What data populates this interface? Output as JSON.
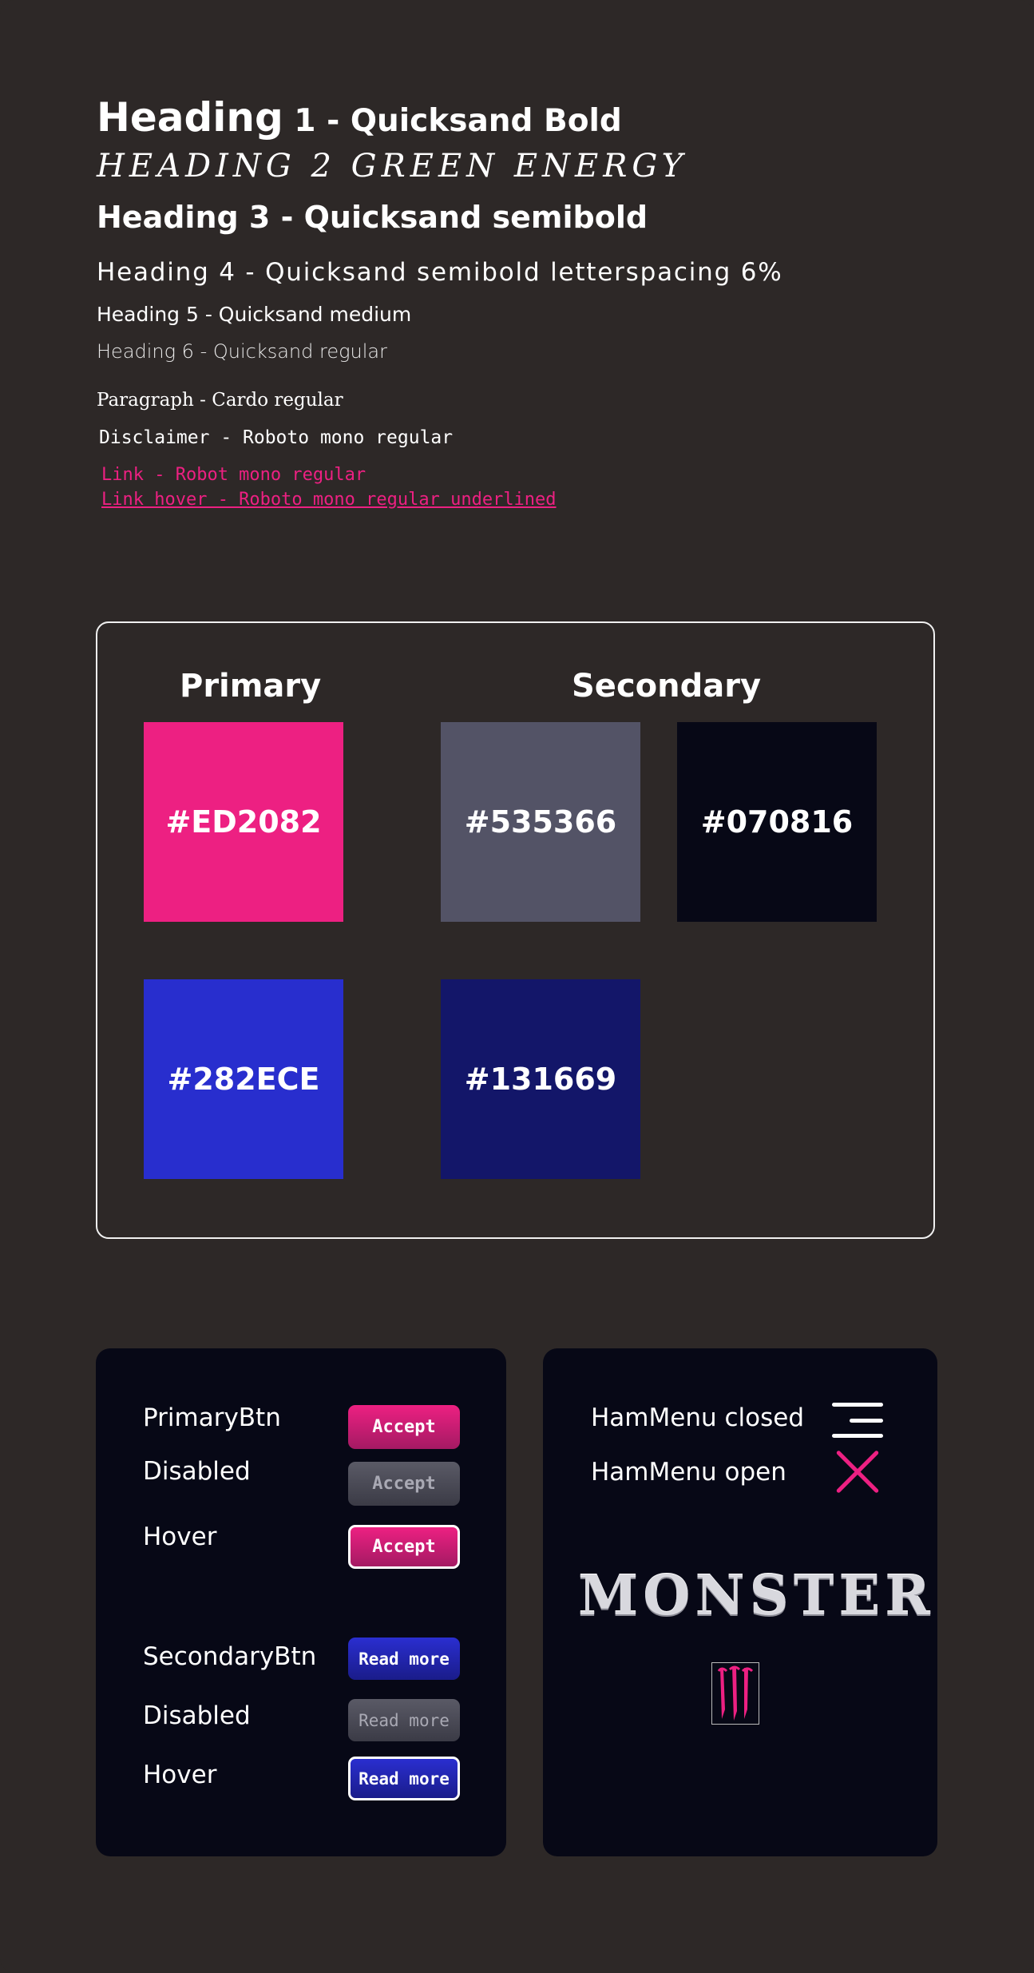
{
  "typography": {
    "h1_big": "Heading",
    "h1_rest": " 1 - Quicksand Bold",
    "h2": "HEADING 2  GREEN ENERGY",
    "h3": "Heading 3 - Quicksand semibold",
    "h4": "Heading 4 - Quicksand semibold  letterspacing 6%",
    "h5": "Heading 5 - Quicksand medium",
    "h6": "Heading 6 - Quicksand regular",
    "paragraph": "Paragraph - Cardo regular",
    "disclaimer": "Disclaimer - Roboto mono regular",
    "link": "Link - Robot mono regular",
    "link_hover": "Link hover - Roboto mono regular underlined"
  },
  "palette": {
    "primary_label": "Primary",
    "secondary_label": "Secondary",
    "swatches": [
      {
        "label": "#ED2082",
        "color": "#ED2082"
      },
      {
        "label": "#535366",
        "color": "#535366"
      },
      {
        "label": "#070816",
        "color": "#070816"
      },
      {
        "label": "#282ECE",
        "color": "#282ECE"
      },
      {
        "label": "#131669",
        "color": "#131669"
      }
    ]
  },
  "buttons": {
    "primary_label": "PrimaryBtn",
    "primary_disabled_label": "Disabled",
    "primary_hover_label": "Hover",
    "accept": "Accept",
    "secondary_label": "SecondaryBtn",
    "secondary_disabled_label": "Disabled",
    "secondary_hover_label": "Hover",
    "read_more": "Read more"
  },
  "menu": {
    "closed_label": "HamMenu closed",
    "open_label": "HamMenu open",
    "closed_icon": "hamburger-icon",
    "open_icon": "close-icon"
  },
  "brand": {
    "logo_text": "MONSTER",
    "logo_icon": "monster-claw-icon",
    "accent": "#ED2082"
  }
}
